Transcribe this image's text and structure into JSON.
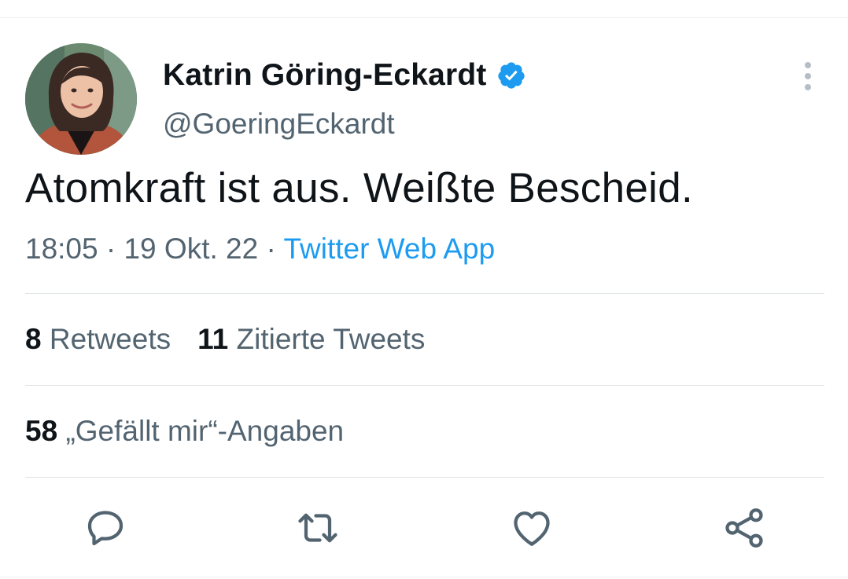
{
  "tweet": {
    "author": {
      "name": "Katrin Göring-Eckardt",
      "handle": "@GoeringEckardt",
      "verified": true
    },
    "text": "Atomkraft ist aus. Weißte Bescheid.",
    "time": "18:05",
    "separator": "·",
    "date": "19 Okt. 22",
    "source": "Twitter Web App"
  },
  "stats": {
    "retweets": {
      "count": "8",
      "label": "Retweets"
    },
    "quotes": {
      "count": "11",
      "label": "Zitierte Tweets"
    },
    "likes": {
      "count": "58",
      "label": "„Gefällt mir“-Angaben"
    }
  },
  "actions": {
    "reply": "reply-icon",
    "retweet": "retweet-icon",
    "like": "heart-icon",
    "share": "share-icon"
  },
  "colors": {
    "text": "#0f1419",
    "secondary": "#536471",
    "accent": "#1d9bf0",
    "verified": "#1d9bf0",
    "divider": "#dde2e6"
  }
}
